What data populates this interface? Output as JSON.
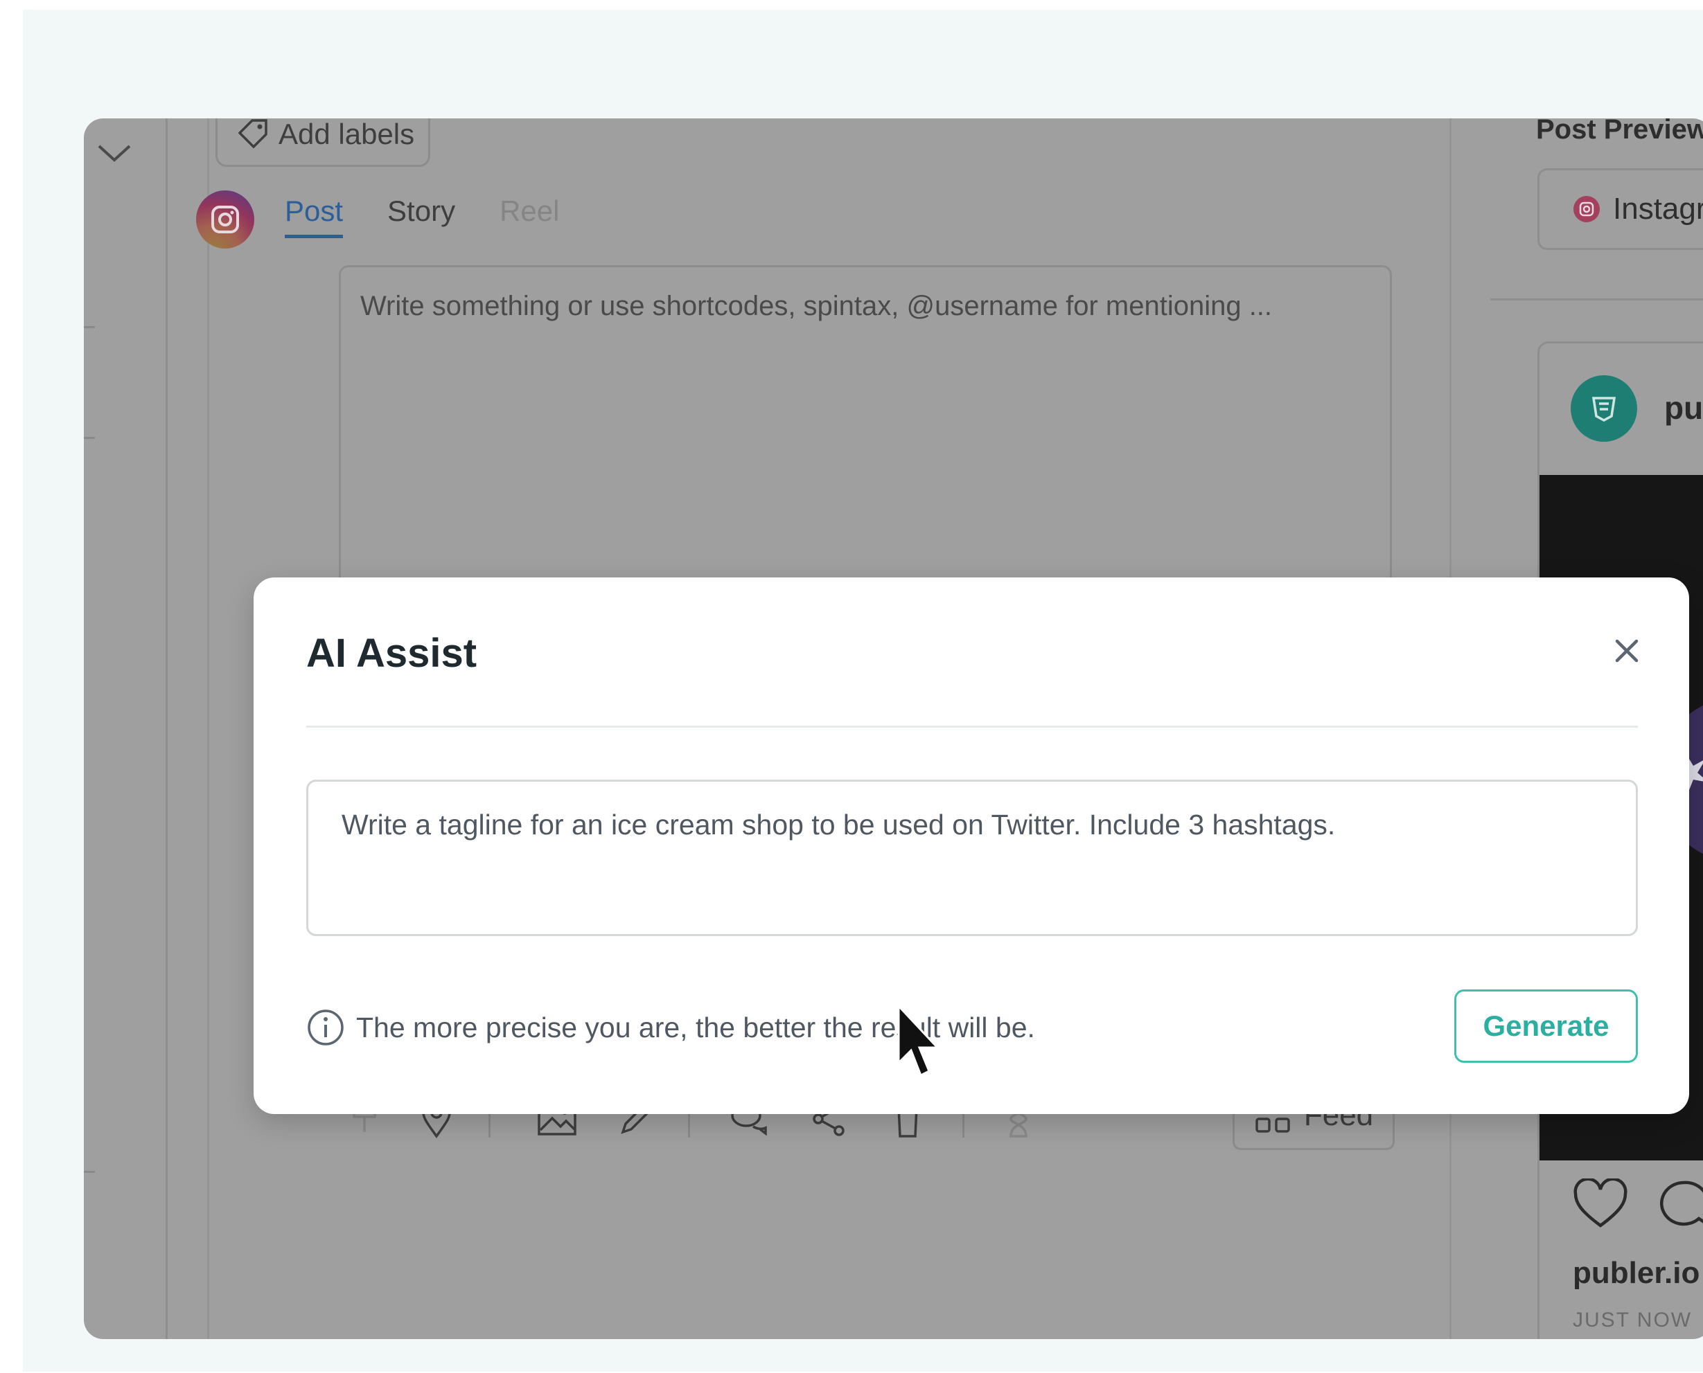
{
  "composer": {
    "add_labels": "Add labels",
    "tabs": [
      {
        "label": "Post",
        "state": "active"
      },
      {
        "label": "Story",
        "state": "normal"
      },
      {
        "label": "Reel",
        "state": "disabled"
      }
    ],
    "editor_placeholder": "Write something or use shortcodes, spintax, @username for mentioning ...",
    "feed_button": "Feed"
  },
  "preview": {
    "title": "Post Preview",
    "network_select": "Instagr",
    "header_name": "pub",
    "account": "publer.io",
    "timestamp": "JUST NOW"
  },
  "modal": {
    "title": "AI Assist",
    "prompt_value": "Write a tagline for an ice cream shop to be used on Twitter. Include 3 hashtags.",
    "hint_text": "The more precise you are, the better the result will be.",
    "generate_label": "Generate"
  },
  "colors": {
    "accent": "#2ab0a0",
    "active_tab": "#2c5f99",
    "overlay": "#9f9f9f"
  }
}
